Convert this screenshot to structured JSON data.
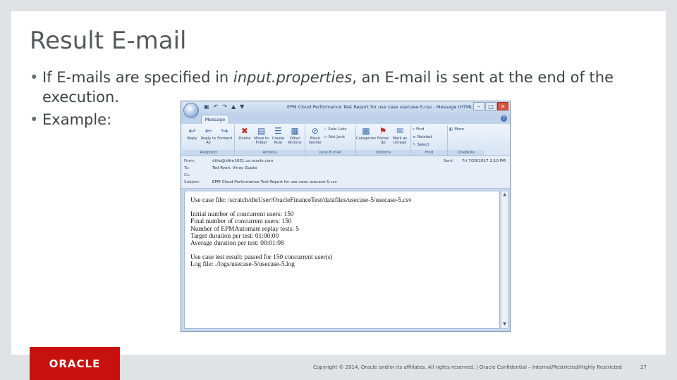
{
  "slide": {
    "title": "Result E-mail",
    "bullets": [
      {
        "pre": "If E-mails are specified in ",
        "em": "input.properties",
        "post": ", an E-mail is sent at the end of the execution."
      },
      {
        "text": "Example:"
      }
    ]
  },
  "outlook": {
    "window_title": "EPM Cloud Performance Test Report for use case usecase-5.csv - Message (HTML)",
    "tab": "Message",
    "groups": [
      {
        "label": "Respond",
        "buttons": [
          "Reply",
          "Reply to All",
          "Forward"
        ]
      },
      {
        "label": "Actions",
        "buttons": [
          "Delete",
          "Move to Folder",
          "Create Rule",
          "Other Actions"
        ]
      },
      {
        "label": "Junk E-mail",
        "buttons": [
          "Block Sender"
        ],
        "small": [
          "Safe Lists",
          "Not Junk"
        ]
      },
      {
        "label": "Options",
        "buttons": [
          "Categorize",
          "Follow Up",
          "Mark as Unread"
        ]
      },
      {
        "label": "Find",
        "small": [
          "Find",
          "Related",
          "Select"
        ]
      },
      {
        "label": "OneNote",
        "small": [
          "More"
        ]
      }
    ],
    "header": {
      "from_label": "From:",
      "from": "ditto@ldtm1631.us.oracle.com",
      "to_label": "To:",
      "to": "Ted Ryan; Vinay Gupta",
      "cc_label": "Cc:",
      "cc": "",
      "subject_label": "Subject:",
      "subject": "EPM Cloud Performance Test Report for use case usecase-5.csv",
      "sent_label": "Sent:",
      "sent": "Fri 7/26/2017 2:10 PM"
    },
    "body": {
      "use_case_file": "Use case file: /scratch/dteUser/OracleFinanceTest/datafiles/usecase-5/usecase-5.csv",
      "stats": [
        "Initial number of concurrent users: 150",
        "Final number of concurrent users: 150",
        "Number of EPMAutomate replay tests: 5",
        "Target duration per test: 01:00:00",
        "Average duration per test: 00:01:08"
      ],
      "result": "Use case test result: passed for 150 concurrent user(s)",
      "log": "Log file: ./logs/usecase-5/usecase-5.log"
    }
  },
  "footer": {
    "brand": "ORACLE",
    "copyright": "Copyright © 2014, Oracle and/or its affiliates. All rights reserved.  |  Oracle Confidential – Internal/Restricted/Highly Restricted",
    "page": "27"
  },
  "colors": {
    "brand_red": "#c7110f",
    "slide_bg": "#dfe3e6"
  }
}
